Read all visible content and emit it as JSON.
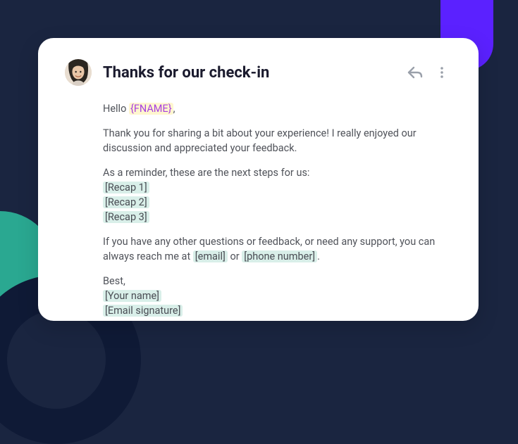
{
  "card": {
    "title": "Thanks for our check-in",
    "greeting_prefix": "Hello ",
    "merge_tag": "{FNAME}",
    "greeting_suffix": ",",
    "thanks_line": "Thank you for sharing a bit about your experience! I really enjoyed our discussion and appreciated your feedback.",
    "reminder_intro": "As a reminder, these are the next steps for us:",
    "recap1": "[Recap 1]",
    "recap2": "[Recap 2]",
    "recap3": "[Recap 3]",
    "support_before": "If you have any other questions or feedback, or need any support, you can always reach me at ",
    "email_ph": "[email]",
    "support_mid": " or ",
    "phone_ph": "[phone number]",
    "support_after": ".",
    "signoff": "Best,",
    "your_name": "[Your name]",
    "signature": "[Email signature]"
  }
}
